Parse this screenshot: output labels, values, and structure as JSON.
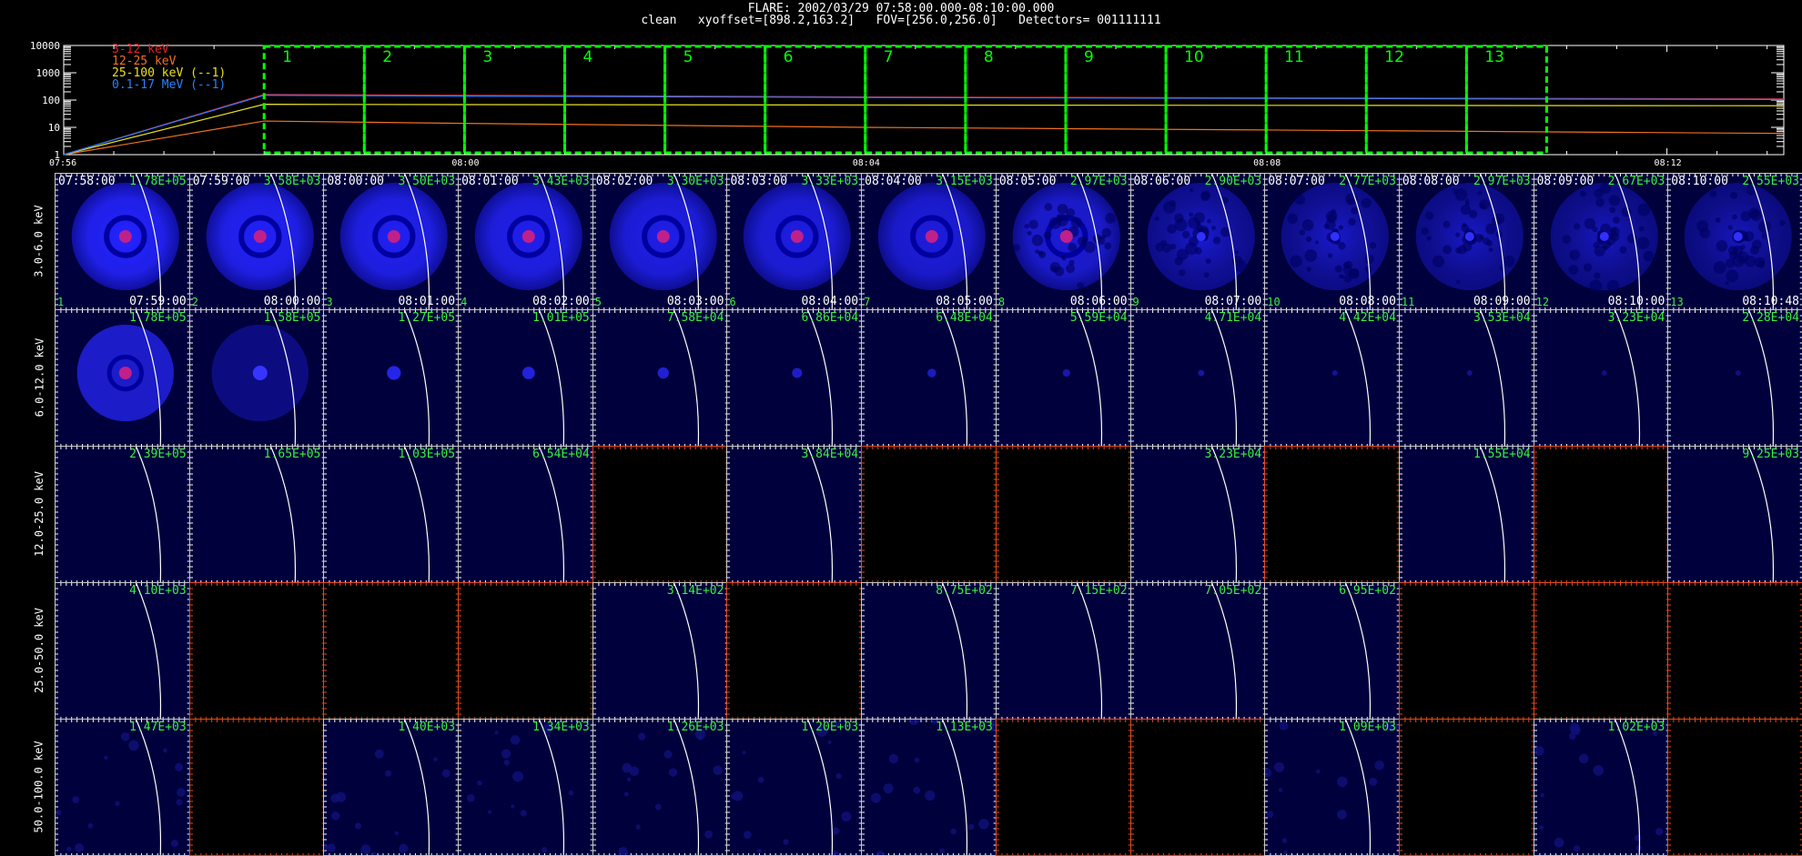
{
  "header": {
    "title": "FLARE: 2002/03/29 07:58:00.000-08:10:00.000",
    "subtitle": "clean   xyoffset=[898.2,163.2]   FOV=[256.0,256.0]   Detectors= 001111111"
  },
  "colors": {
    "lc_3_12": "#e02020",
    "lc_12_25": "#f07020",
    "lc_25_100": "#e8e020",
    "lc_01_17": "#2a80ff",
    "intervals": "#00ff00",
    "value_text": "#3cf03c",
    "empty_border": "#e24a1a"
  },
  "chart_data": {
    "type": "line",
    "title": "",
    "xlabel": "",
    "ylabel": "",
    "scale": "log",
    "ylim": [
      1,
      10000
    ],
    "y_ticks": [
      "10000",
      "1000",
      "100",
      "10",
      "1"
    ],
    "x_tick_labels": [
      "07:56",
      "08:00",
      "08:04",
      "08:08",
      "08:12"
    ],
    "x_tick_times": [
      "07:56",
      "08:00",
      "08:04",
      "08:08",
      "08:12"
    ],
    "xlim": [
      "07:56",
      "08:13:10"
    ],
    "legend": [
      {
        "name": "3-12 keV",
        "color": "#e02020"
      },
      {
        "name": "12-25 keV",
        "color": "#f07020"
      },
      {
        "name": "25-100 keV (--1)",
        "color": "#e8e020"
      },
      {
        "name": "0.1-17 MeV (--1)",
        "color": "#2a80ff"
      }
    ],
    "series": [
      {
        "name": "3-12 keV",
        "times": [
          "07:56",
          "07:58:00",
          "08:00",
          "08:04",
          "08:08",
          "08:13:10"
        ],
        "values": [
          1,
          160,
          150,
          130,
          120,
          110
        ]
      },
      {
        "name": "12-25 keV",
        "times": [
          "07:56",
          "07:58:00",
          "08:00",
          "08:04",
          "08:08",
          "08:13:10"
        ],
        "values": [
          1,
          17,
          14,
          10,
          8,
          6
        ]
      },
      {
        "name": "25-100 keV (--1)",
        "times": [
          "07:56",
          "07:58:00",
          "08:00",
          "08:04",
          "08:08",
          "08:13:10"
        ],
        "values": [
          1,
          70,
          68,
          66,
          64,
          62
        ]
      },
      {
        "name": "0.1-17 MeV (--1)",
        "times": [
          "07:56",
          "07:58:00",
          "08:00",
          "08:04",
          "08:08",
          "08:13:10"
        ],
        "values": [
          1,
          150,
          140,
          125,
          115,
          105
        ]
      }
    ],
    "intervals": [
      {
        "label": "1",
        "start": "07:58:00",
        "end": "07:59:00"
      },
      {
        "label": "2",
        "start": "07:59:00",
        "end": "08:00:00"
      },
      {
        "label": "3",
        "start": "08:00:00",
        "end": "08:01:00"
      },
      {
        "label": "4",
        "start": "08:01:00",
        "end": "08:02:00"
      },
      {
        "label": "5",
        "start": "08:02:00",
        "end": "08:03:00"
      },
      {
        "label": "6",
        "start": "08:03:00",
        "end": "08:04:00"
      },
      {
        "label": "7",
        "start": "08:04:00",
        "end": "08:05:00"
      },
      {
        "label": "8",
        "start": "08:05:00",
        "end": "08:06:00"
      },
      {
        "label": "9",
        "start": "08:06:00",
        "end": "08:07:00"
      },
      {
        "label": "10",
        "start": "08:07:00",
        "end": "08:08:00"
      },
      {
        "label": "11",
        "start": "08:08:00",
        "end": "08:09:00"
      },
      {
        "label": "12",
        "start": "08:09:00",
        "end": "08:10:00"
      },
      {
        "label": "13",
        "start": "08:10:00",
        "end": "08:10:48"
      }
    ]
  },
  "grid": {
    "energy_bands": [
      "3.0-6.0 keV",
      "6.0-12.0 keV",
      "12.0-25.0 keV",
      "25.0-50.0 keV",
      "50.0-100.0 keV"
    ],
    "start_times": [
      "07:58:00",
      "07:59:00",
      "08:00:00",
      "08:01:00",
      "08:02:00",
      "08:03:00",
      "08:04:00",
      "08:05:00",
      "08:06:00",
      "08:07:00",
      "08:08:00",
      "08:09:00",
      "08:10:00"
    ],
    "end_times": [
      "07:59:00",
      "08:00:00",
      "08:01:00",
      "08:02:00",
      "08:03:00",
      "08:04:00",
      "08:05:00",
      "08:06:00",
      "08:07:00",
      "08:08:00",
      "08:09:00",
      "08:10:00",
      "08:10:48"
    ],
    "interval_numbers": [
      "1",
      "2",
      "3",
      "4",
      "5",
      "6",
      "7",
      "8",
      "9",
      "10",
      "11",
      "12",
      "13"
    ],
    "values": [
      [
        "1.78E+05",
        "3.58E+03",
        "3.50E+03",
        "3.43E+03",
        "3.30E+03",
        "3.33E+03",
        "3.15E+03",
        "2.97E+03",
        "2.90E+03",
        "2.77E+03",
        "2.97E+03",
        "2.67E+03",
        "2.55E+03"
      ],
      [
        "1.78E+05",
        "1.58E+05",
        "1.27E+05",
        "1.01E+05",
        "7.58E+04",
        "6.86E+04",
        "6.48E+04",
        "5.59E+04",
        "4.71E+04",
        "4.42E+04",
        "3.53E+04",
        "3.23E+04",
        "2.28E+04"
      ],
      [
        "2.39E+05",
        "1.65E+05",
        "1.03E+05",
        "6.54E+04",
        null,
        "3.84E+04",
        null,
        null,
        "3.23E+04",
        null,
        "1.55E+04",
        null,
        "9.25E+03"
      ],
      [
        "4.10E+03",
        null,
        null,
        null,
        "3.14E+02",
        null,
        "8.75E+02",
        "7.15E+02",
        "7.05E+02",
        "6.95E+02",
        null,
        null,
        null
      ],
      [
        "1.47E+03",
        null,
        "1.40E+03",
        "1.34E+03",
        "1.26E+03",
        "1.20E+03",
        "1.13E+03",
        null,
        null,
        "1.09E+03",
        null,
        "1.02E+03",
        null
      ]
    ]
  }
}
